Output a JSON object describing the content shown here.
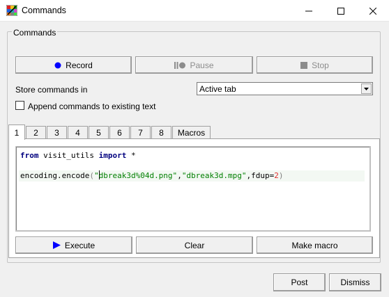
{
  "window": {
    "title": "Commands",
    "controls": {
      "minimize": "minimize-icon",
      "maximize": "maximize-icon",
      "close": "close-icon"
    }
  },
  "commands_group": {
    "label": "Commands",
    "record_label": "Record",
    "pause_label": "Pause",
    "stop_label": "Stop",
    "store_label": "Store commands in",
    "store_value": "Active tab",
    "append_label": "Append commands to existing text",
    "append_checked": false
  },
  "tabs": [
    {
      "label": "1",
      "active": true
    },
    {
      "label": "2",
      "active": false
    },
    {
      "label": "3",
      "active": false
    },
    {
      "label": "4",
      "active": false
    },
    {
      "label": "5",
      "active": false
    },
    {
      "label": "6",
      "active": false
    },
    {
      "label": "7",
      "active": false
    },
    {
      "label": "8",
      "active": false
    },
    {
      "label": "Macros",
      "active": false
    }
  ],
  "editor": {
    "line1": {
      "kw1": "from",
      "module": " visit_utils ",
      "kw2": "import",
      "rest": " *"
    },
    "line2": {
      "call": "encoding.encode",
      "open": "(",
      "q1": "\"",
      "arg1": "dbreak3d%04d.png\"",
      "sep1": ",",
      "arg2": "\"dbreak3d.mpg\"",
      "sep2": ",fdup=",
      "num": "2",
      "close": ")"
    }
  },
  "panel_buttons": {
    "execute_label": "Execute",
    "clear_label": "Clear",
    "make_macro_label": "Make macro"
  },
  "dialog_buttons": {
    "post_label": "Post",
    "dismiss_label": "Dismiss"
  },
  "colors": {
    "record_dot": "#0000ff",
    "execute_arrow": "#0000ff",
    "disabled_text": "#8c8c8c"
  }
}
